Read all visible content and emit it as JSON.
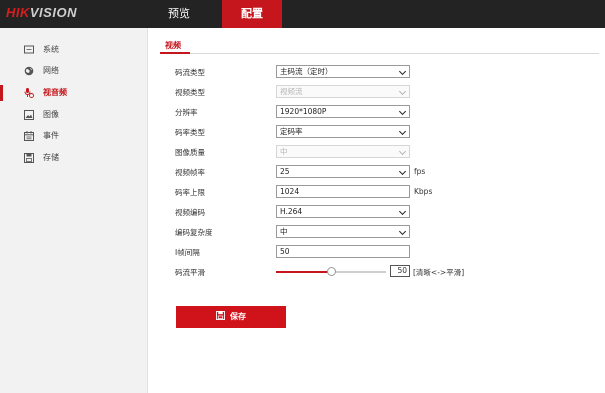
{
  "brand": {
    "logo_red": "HIK",
    "logo_grey": "VISION"
  },
  "topnav": {
    "preview": "预览",
    "config": "配置"
  },
  "sidebar": {
    "items": [
      {
        "label": "系统",
        "icon": "monitor-icon"
      },
      {
        "label": "网络",
        "icon": "globe-icon"
      },
      {
        "label": "视音频",
        "icon": "microphone-camera-icon"
      },
      {
        "label": "图像",
        "icon": "image-icon"
      },
      {
        "label": "事件",
        "icon": "calendar-icon"
      },
      {
        "label": "存储",
        "icon": "save-disk-icon"
      }
    ],
    "active_index": 2
  },
  "tabs": {
    "video": "视频"
  },
  "form": {
    "stream_type": {
      "label": "码流类型",
      "value": "主码流（定时）"
    },
    "video_type": {
      "label": "视频类型",
      "value": "视频流"
    },
    "resolution": {
      "label": "分辨率",
      "value": "1920*1080P"
    },
    "bitrate_type": {
      "label": "码率类型",
      "value": "定码率"
    },
    "image_quality": {
      "label": "图像质量",
      "value": "中"
    },
    "frame_rate": {
      "label": "视频帧率",
      "value": "25",
      "unit": "fps"
    },
    "bitrate_limit": {
      "label": "码率上限",
      "value": "1024",
      "unit": "Kbps"
    },
    "video_encoding": {
      "label": "视频编码",
      "value": "H.264"
    },
    "encoding_complexity": {
      "label": "编码复杂度",
      "value": "中"
    },
    "i_frame_interval": {
      "label": "I帧间隔",
      "value": "50"
    },
    "stream_smoothing": {
      "label": "码流平滑",
      "value": "50",
      "fraction": 0.5,
      "hint": "[清晰<->平滑]"
    }
  },
  "save": {
    "label": "保存"
  },
  "colors": {
    "accent": "#c4161c",
    "topbar": "#232323",
    "sidebar": "#f2f2f2"
  }
}
